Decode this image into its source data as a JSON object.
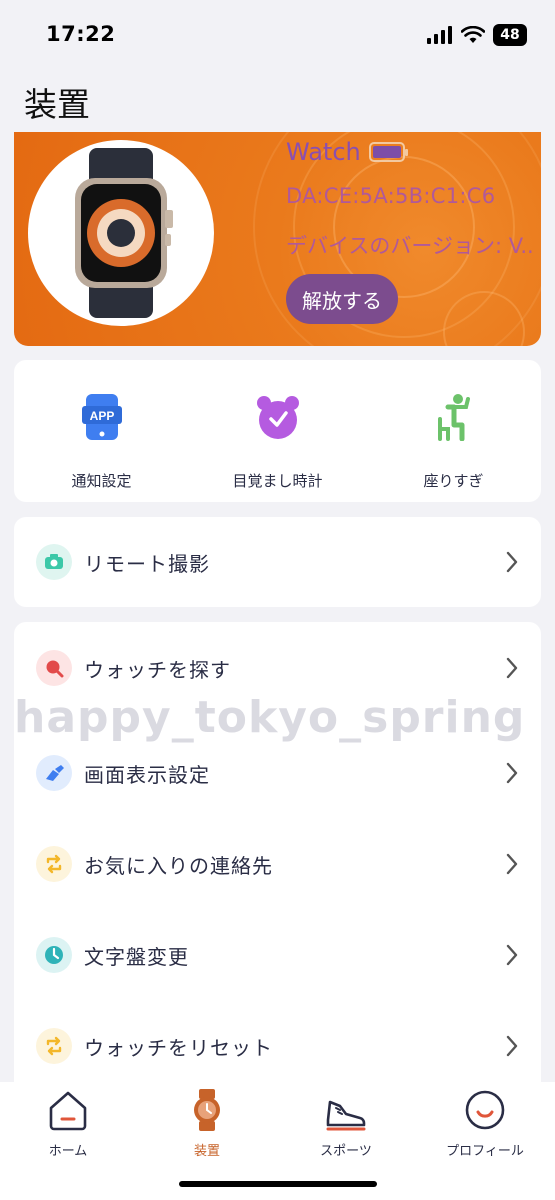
{
  "status_bar": {
    "time": "17:22",
    "battery": "48"
  },
  "page_title": "装置",
  "device": {
    "name": "Watch",
    "mac": "DA:CE:5A:5B:C1:C6",
    "version": "デバイスのバージョン: V...",
    "release_label": "解放する",
    "battery_level": 1.0,
    "colors": {
      "banner": "#e87418",
      "release_button": "#7c4c8e",
      "text": "#b0599a"
    }
  },
  "quick_actions": [
    {
      "label": "通知設定",
      "icon": "app-notification-icon"
    },
    {
      "label": "目覚まし時計",
      "icon": "alarm-clock-icon"
    },
    {
      "label": "座りすぎ",
      "icon": "sedentary-icon"
    }
  ],
  "remote": {
    "label": "リモート撮影",
    "icon": "camera-icon"
  },
  "settings": [
    {
      "label": "ウォッチを探す",
      "icon": "search-icon"
    },
    {
      "label": "画面表示設定",
      "icon": "brush-icon"
    },
    {
      "label": "お気に入りの連絡先",
      "icon": "sync-icon"
    },
    {
      "label": "文字盤変更",
      "icon": "clock-icon"
    },
    {
      "label": "ウォッチをリセット",
      "icon": "reset-icon"
    }
  ],
  "watermark": "happy_tokyo_spring",
  "tabs": [
    {
      "label": "ホーム",
      "icon": "home-icon",
      "active": false
    },
    {
      "label": "装置",
      "icon": "watch-icon",
      "active": true
    },
    {
      "label": "スポーツ",
      "icon": "shoe-icon",
      "active": false
    },
    {
      "label": "プロフィール",
      "icon": "profile-icon",
      "active": false
    }
  ],
  "accent_color": "#c7632a"
}
